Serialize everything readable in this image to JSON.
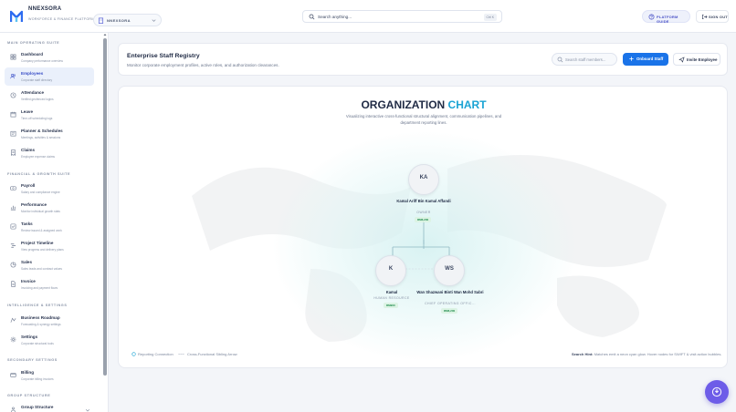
{
  "app": {
    "brand": "NNEXSORA",
    "tagline": "WORKFORCE & FINANCE PLATFORM",
    "org_selector": "NNEXSORA"
  },
  "topbar": {
    "search_placeholder": "Search anything...",
    "search_shortcut": "Ctrl K",
    "guide_label": "PLATFORM GUIDE",
    "signout_label": "SIGN OUT"
  },
  "sidebar": {
    "sections": [
      "MAIN OPERATING SUITE",
      "FINANCIAL & GROWTH SUITE",
      "INTELLIGENCE & SETTINGS",
      "SECONDARY SETTINGS",
      "GROUP STRUCTURE"
    ],
    "items": [
      {
        "label": "Dashboard",
        "sub": "Company performance overview",
        "icon": "grid-icon"
      },
      {
        "label": "Employees",
        "sub": "Corporate staff directory",
        "icon": "users-icon"
      },
      {
        "label": "Attendance",
        "sub": "Verified geofenced logins",
        "icon": "clock-icon"
      },
      {
        "label": "Leave",
        "sub": "Time-off scheduling logs",
        "icon": "calendar-icon"
      },
      {
        "label": "Planner & Schedules",
        "sub": "Meetings, activities & sessions",
        "icon": "planner-icon"
      },
      {
        "label": "Claims",
        "sub": "Employee expense claims",
        "icon": "receipt-icon"
      },
      {
        "label": "Payroll",
        "sub": "Salary and compliance engine",
        "icon": "payroll-icon"
      },
      {
        "label": "Performance",
        "sub": "Monitor individual growth stats",
        "icon": "chart-icon"
      },
      {
        "label": "Tasks",
        "sub": "Review issued & assigned work",
        "icon": "tasks-icon"
      },
      {
        "label": "Project Timeline",
        "sub": "View progress and delivery plans",
        "icon": "timeline-icon"
      },
      {
        "label": "Sales",
        "sub": "Sales leads and contract values",
        "icon": "sales-icon"
      },
      {
        "label": "Invoice",
        "sub": "Invoicing and payment flows",
        "icon": "invoice-icon"
      },
      {
        "label": "Business Roadmap",
        "sub": "Forecasting & synergy settings",
        "icon": "roadmap-icon"
      },
      {
        "label": "Settings",
        "sub": "Corporate structural tools",
        "icon": "gear-icon"
      },
      {
        "label": "Billing",
        "sub": "Corporate billing invoices",
        "icon": "billing-icon"
      },
      {
        "label": "Group Structure",
        "sub": "",
        "icon": "group-icon"
      }
    ]
  },
  "header": {
    "title": "Enterprise Staff Registry",
    "subtitle": "Monitor corporate employment profiles, active roles, and authorization clearances.",
    "staff_search_placeholder": "Search staff members...",
    "onboard_label": "Onboard Staff",
    "invite_label": "Invite Employee"
  },
  "org_chart": {
    "title_main": "ORGANIZATION ",
    "title_accent": "CHART",
    "description": "Visualizing interactive cross-functional structural alignment, communication pipelines, and department reporting lines.",
    "nodes": [
      {
        "initials": "KA",
        "name": "Kamal Ariff Bin Kamal Affandi",
        "role": "OWNER",
        "badge": "RM6,200"
      },
      {
        "initials": "K",
        "name": "Kamal",
        "role": "HUMAN RESOURCE",
        "badge": "RM900"
      },
      {
        "initials": "WS",
        "name": "Wan Shazwani Binti Wan Mohd Sabri",
        "role": "CHIEF OPERATING OFFIC...",
        "badge": "RM6,200"
      }
    ],
    "legend_reporting": "Reporting Connection",
    "legend_sibling": "Cross-Functional Sibling Arrow",
    "hint_label": "Search Hint:",
    "hint_text": "Matches emit a neon cyan glow. Hover nodes for SWIFT & visit action bubbles."
  },
  "colors": {
    "primary": "#1a73e8",
    "accent_cyan": "#1aa3d4",
    "fab": "#6d5ce8",
    "badge_green": "#1c8a4a"
  }
}
